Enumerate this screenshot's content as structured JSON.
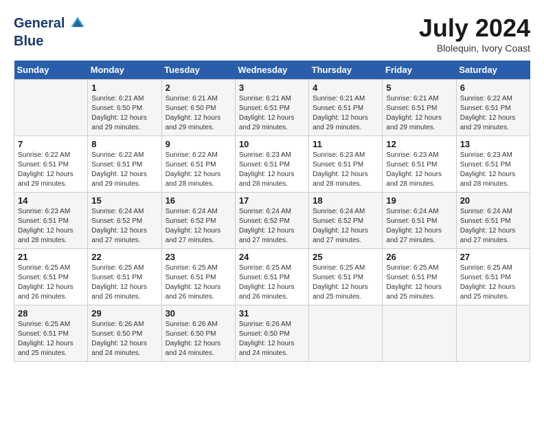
{
  "header": {
    "logo_general": "General",
    "logo_blue": "Blue",
    "month_year": "July 2024",
    "location": "Blolequin, Ivory Coast"
  },
  "weekdays": [
    "Sunday",
    "Monday",
    "Tuesday",
    "Wednesday",
    "Thursday",
    "Friday",
    "Saturday"
  ],
  "weeks": [
    [
      {
        "day": "",
        "sunrise": "",
        "sunset": "",
        "daylight": ""
      },
      {
        "day": "1",
        "sunrise": "Sunrise: 6:21 AM",
        "sunset": "Sunset: 6:50 PM",
        "daylight": "Daylight: 12 hours and 29 minutes."
      },
      {
        "day": "2",
        "sunrise": "Sunrise: 6:21 AM",
        "sunset": "Sunset: 6:50 PM",
        "daylight": "Daylight: 12 hours and 29 minutes."
      },
      {
        "day": "3",
        "sunrise": "Sunrise: 6:21 AM",
        "sunset": "Sunset: 6:51 PM",
        "daylight": "Daylight: 12 hours and 29 minutes."
      },
      {
        "day": "4",
        "sunrise": "Sunrise: 6:21 AM",
        "sunset": "Sunset: 6:51 PM",
        "daylight": "Daylight: 12 hours and 29 minutes."
      },
      {
        "day": "5",
        "sunrise": "Sunrise: 6:21 AM",
        "sunset": "Sunset: 6:51 PM",
        "daylight": "Daylight: 12 hours and 29 minutes."
      },
      {
        "day": "6",
        "sunrise": "Sunrise: 6:22 AM",
        "sunset": "Sunset: 6:51 PM",
        "daylight": "Daylight: 12 hours and 29 minutes."
      }
    ],
    [
      {
        "day": "7",
        "sunrise": "Sunrise: 6:22 AM",
        "sunset": "Sunset: 6:51 PM",
        "daylight": "Daylight: 12 hours and 29 minutes."
      },
      {
        "day": "8",
        "sunrise": "Sunrise: 6:22 AM",
        "sunset": "Sunset: 6:51 PM",
        "daylight": "Daylight: 12 hours and 29 minutes."
      },
      {
        "day": "9",
        "sunrise": "Sunrise: 6:22 AM",
        "sunset": "Sunset: 6:51 PM",
        "daylight": "Daylight: 12 hours and 28 minutes."
      },
      {
        "day": "10",
        "sunrise": "Sunrise: 6:23 AM",
        "sunset": "Sunset: 6:51 PM",
        "daylight": "Daylight: 12 hours and 28 minutes."
      },
      {
        "day": "11",
        "sunrise": "Sunrise: 6:23 AM",
        "sunset": "Sunset: 6:51 PM",
        "daylight": "Daylight: 12 hours and 28 minutes."
      },
      {
        "day": "12",
        "sunrise": "Sunrise: 6:23 AM",
        "sunset": "Sunset: 6:51 PM",
        "daylight": "Daylight: 12 hours and 28 minutes."
      },
      {
        "day": "13",
        "sunrise": "Sunrise: 6:23 AM",
        "sunset": "Sunset: 6:51 PM",
        "daylight": "Daylight: 12 hours and 28 minutes."
      }
    ],
    [
      {
        "day": "14",
        "sunrise": "Sunrise: 6:23 AM",
        "sunset": "Sunset: 6:51 PM",
        "daylight": "Daylight: 12 hours and 28 minutes."
      },
      {
        "day": "15",
        "sunrise": "Sunrise: 6:24 AM",
        "sunset": "Sunset: 6:52 PM",
        "daylight": "Daylight: 12 hours and 27 minutes."
      },
      {
        "day": "16",
        "sunrise": "Sunrise: 6:24 AM",
        "sunset": "Sunset: 6:52 PM",
        "daylight": "Daylight: 12 hours and 27 minutes."
      },
      {
        "day": "17",
        "sunrise": "Sunrise: 6:24 AM",
        "sunset": "Sunset: 6:52 PM",
        "daylight": "Daylight: 12 hours and 27 minutes."
      },
      {
        "day": "18",
        "sunrise": "Sunrise: 6:24 AM",
        "sunset": "Sunset: 6:52 PM",
        "daylight": "Daylight: 12 hours and 27 minutes."
      },
      {
        "day": "19",
        "sunrise": "Sunrise: 6:24 AM",
        "sunset": "Sunset: 6:51 PM",
        "daylight": "Daylight: 12 hours and 27 minutes."
      },
      {
        "day": "20",
        "sunrise": "Sunrise: 6:24 AM",
        "sunset": "Sunset: 6:51 PM",
        "daylight": "Daylight: 12 hours and 27 minutes."
      }
    ],
    [
      {
        "day": "21",
        "sunrise": "Sunrise: 6:25 AM",
        "sunset": "Sunset: 6:51 PM",
        "daylight": "Daylight: 12 hours and 26 minutes."
      },
      {
        "day": "22",
        "sunrise": "Sunrise: 6:25 AM",
        "sunset": "Sunset: 6:51 PM",
        "daylight": "Daylight: 12 hours and 26 minutes."
      },
      {
        "day": "23",
        "sunrise": "Sunrise: 6:25 AM",
        "sunset": "Sunset: 6:51 PM",
        "daylight": "Daylight: 12 hours and 26 minutes."
      },
      {
        "day": "24",
        "sunrise": "Sunrise: 6:25 AM",
        "sunset": "Sunset: 6:51 PM",
        "daylight": "Daylight: 12 hours and 26 minutes."
      },
      {
        "day": "25",
        "sunrise": "Sunrise: 6:25 AM",
        "sunset": "Sunset: 6:51 PM",
        "daylight": "Daylight: 12 hours and 25 minutes."
      },
      {
        "day": "26",
        "sunrise": "Sunrise: 6:25 AM",
        "sunset": "Sunset: 6:51 PM",
        "daylight": "Daylight: 12 hours and 25 minutes."
      },
      {
        "day": "27",
        "sunrise": "Sunrise: 6:25 AM",
        "sunset": "Sunset: 6:51 PM",
        "daylight": "Daylight: 12 hours and 25 minutes."
      }
    ],
    [
      {
        "day": "28",
        "sunrise": "Sunrise: 6:25 AM",
        "sunset": "Sunset: 6:51 PM",
        "daylight": "Daylight: 12 hours and 25 minutes."
      },
      {
        "day": "29",
        "sunrise": "Sunrise: 6:26 AM",
        "sunset": "Sunset: 6:50 PM",
        "daylight": "Daylight: 12 hours and 24 minutes."
      },
      {
        "day": "30",
        "sunrise": "Sunrise: 6:26 AM",
        "sunset": "Sunset: 6:50 PM",
        "daylight": "Daylight: 12 hours and 24 minutes."
      },
      {
        "day": "31",
        "sunrise": "Sunrise: 6:26 AM",
        "sunset": "Sunset: 6:50 PM",
        "daylight": "Daylight: 12 hours and 24 minutes."
      },
      {
        "day": "",
        "sunrise": "",
        "sunset": "",
        "daylight": ""
      },
      {
        "day": "",
        "sunrise": "",
        "sunset": "",
        "daylight": ""
      },
      {
        "day": "",
        "sunrise": "",
        "sunset": "",
        "daylight": ""
      }
    ]
  ]
}
